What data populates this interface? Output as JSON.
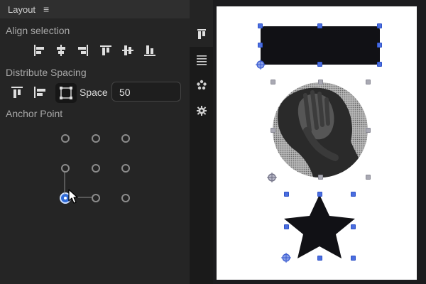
{
  "panel": {
    "title": "Layout",
    "menu_icon": "hamburger-icon",
    "align_label": "Align selection",
    "align_buttons": [
      "align-left-icon",
      "align-center-horizontal-icon",
      "align-right-icon",
      "align-top-icon",
      "align-middle-vertical-icon",
      "align-bottom-icon"
    ],
    "distribute_label": "Distribute Spacing",
    "distribute_buttons": [
      "distribute-vertical-icon",
      "distribute-horizontal-icon",
      "distribute-selection-icon"
    ],
    "space_label": "Space",
    "space_value": "50",
    "anchor_label": "Anchor Point",
    "anchor_selected": "bottom-left"
  },
  "rail": {
    "icons": [
      "layout-icon",
      "layers-icon",
      "components-icon",
      "settings-icon"
    ],
    "active": "layout-icon"
  },
  "colors": {
    "accent": "#4a6ee0",
    "panel_bg": "#252525",
    "canvas_page": "#ffffff",
    "shape_fill": "#111115"
  }
}
